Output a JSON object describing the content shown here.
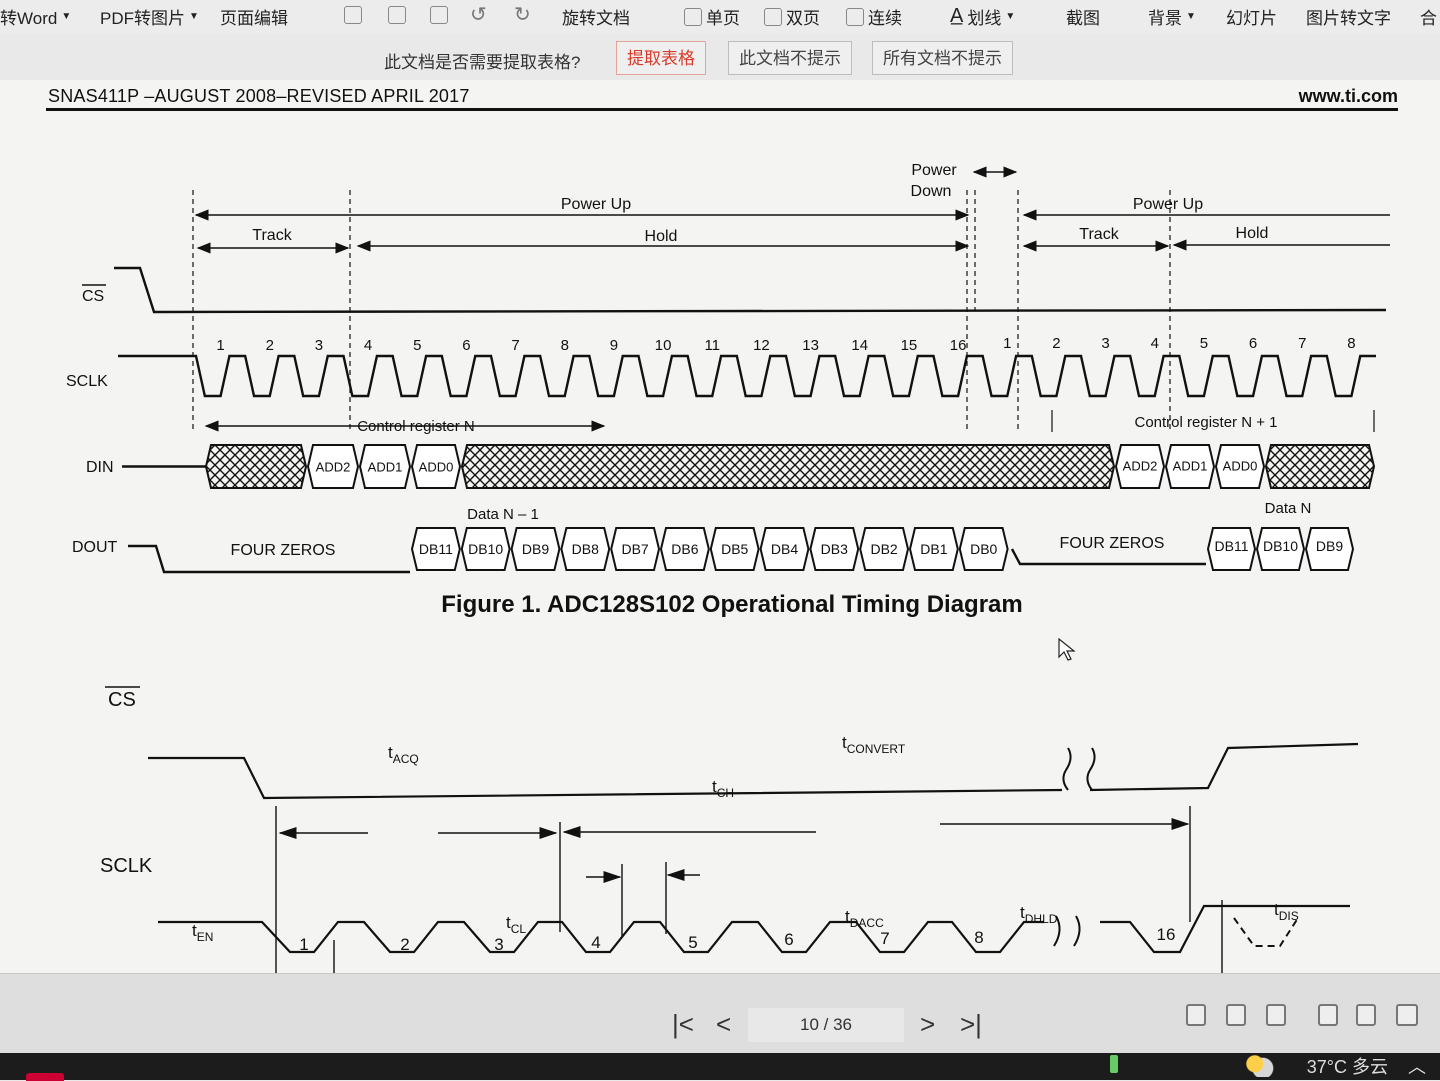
{
  "toolbar": {
    "items": [
      {
        "label": "转Word",
        "caret": true
      },
      {
        "label": "PDF转图片",
        "caret": true
      },
      {
        "label": "页面编辑",
        "caret": false
      },
      {
        "label": "旋转文档",
        "caret": false
      },
      {
        "label": "单页",
        "caret": false
      },
      {
        "label": "双页",
        "caret": false
      },
      {
        "label": "连续",
        "caret": false
      },
      {
        "label": "划线",
        "caret": true
      },
      {
        "label": "截图",
        "caret": false
      },
      {
        "label": "背景",
        "caret": true
      },
      {
        "label": "幻灯片",
        "caret": false
      },
      {
        "label": "图片转文字",
        "caret": false
      },
      {
        "label": "合",
        "caret": false
      }
    ]
  },
  "prompt_bar": {
    "question": "此文档是否需要提取表格?",
    "extract_label": "提取表格",
    "no_prompt_doc_label": "此文档不提示",
    "no_prompt_all_label": "所有文档不提示"
  },
  "document": {
    "header_left": "SNAS411P –AUGUST 2008–REVISED APRIL 2017",
    "header_right": "www.ti.com",
    "figure1": {
      "caption": "Figure 1.  ADC128S102 Operational Timing Diagram",
      "phases": {
        "power_up": "Power Up",
        "power_down_1": "Power",
        "power_down_2": "Down",
        "track": "Track",
        "hold": "Hold"
      },
      "signals": {
        "cs": "CS",
        "sclk": "SCLK",
        "din": "DIN",
        "dout": "DOUT"
      },
      "clock_numbers_first": [
        "1",
        "2",
        "3",
        "4",
        "5",
        "6",
        "7",
        "8",
        "9",
        "10",
        "11",
        "12",
        "13",
        "14",
        "15",
        "16"
      ],
      "clock_numbers_second": [
        "1",
        "2",
        "3",
        "4",
        "5",
        "6",
        "7",
        "8"
      ],
      "control_register_n": "Control register N",
      "control_register_n1": "Control register N + 1",
      "din_bits": [
        "ADD2",
        "ADD1",
        "ADD0"
      ],
      "data_n_minus_1": "Data N – 1",
      "data_n": "Data N",
      "four_zeros": "FOUR ZEROS",
      "dout_bits": [
        "DB11",
        "DB10",
        "DB9",
        "DB8",
        "DB7",
        "DB6",
        "DB5",
        "DB4",
        "DB3",
        "DB2",
        "DB1",
        "DB0"
      ],
      "dout_bits_n": [
        "DB11",
        "DB10",
        "DB9"
      ]
    },
    "figure2": {
      "signals": {
        "cs": "CS",
        "sclk": "SCLK"
      },
      "clock_numbers": [
        "1",
        "2",
        "3",
        "4",
        "5",
        "6",
        "7",
        "8",
        "16"
      ],
      "timing": {
        "t_acq": [
          "t",
          "ACQ"
        ],
        "t_convert": [
          "t",
          "CONVERT"
        ],
        "t_ch": [
          "t",
          "CH"
        ],
        "t_en": [
          "t",
          "EN"
        ],
        "t_cl": [
          "t",
          "CL"
        ],
        "t_dacc": [
          "t",
          "DACC"
        ],
        "t_dhld": [
          "t",
          "DHLD"
        ],
        "t_dis": [
          "t",
          "DIS"
        ]
      }
    }
  },
  "navigation": {
    "page_indicator": "10 / 36",
    "first_icon": "first-page-icon",
    "prev_icon": "prev-page-icon",
    "next_icon": "next-page-icon",
    "last_icon": "last-page-icon"
  },
  "taskbar": {
    "weather": "37°C 多云",
    "weather_icon": "partly-cloudy-icon"
  }
}
